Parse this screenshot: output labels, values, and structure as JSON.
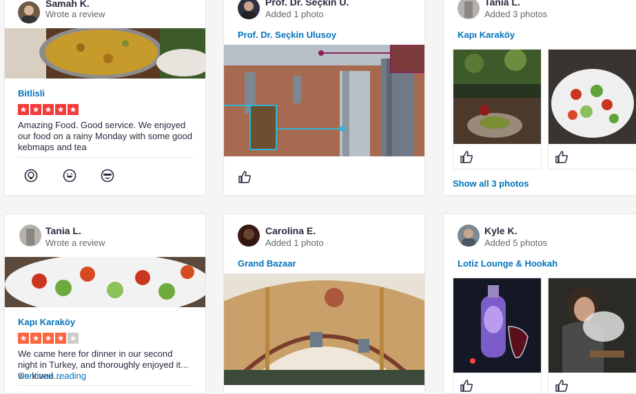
{
  "cards": [
    {
      "user": "Samah K.",
      "action": "Wrote a review",
      "business": "Bitlisli",
      "rating": 5,
      "text": "Amazing Food. Good service. We enjoyed our food on a rainy Monday with some good kebmaps and tea",
      "reactions": [
        "useful-icon",
        "funny-icon",
        "cool-icon"
      ]
    },
    {
      "user": "Prof. Dr. Seçkin U.",
      "action": "Added 1 photo",
      "business": "Prof. Dr. Seçkin Ulusoy"
    },
    {
      "user": "Tania L.",
      "action": "Added 3 photos",
      "business": "Kapı Karaköy",
      "show_all": "Show all 3 photos"
    },
    {
      "user": "Tania L.",
      "action": "Wrote a review",
      "business": "Kapı Karaköy",
      "rating": 4,
      "text": "We came here for dinner in our second night in Turkey, and thoroughly enjoyed it... we loved...",
      "continue": "Continue reading"
    },
    {
      "user": "Carolina E.",
      "action": "Added 1 photo",
      "business": "Grand Bazaar"
    },
    {
      "user": "Kyle K.",
      "action": "Added 5 photos",
      "business": "Lotiz Lounge & Hookah"
    }
  ],
  "colors": {
    "star_on": "#f43939",
    "star_half": "#ff643d",
    "star_off": "#cccccc",
    "link": "#0073bb"
  }
}
